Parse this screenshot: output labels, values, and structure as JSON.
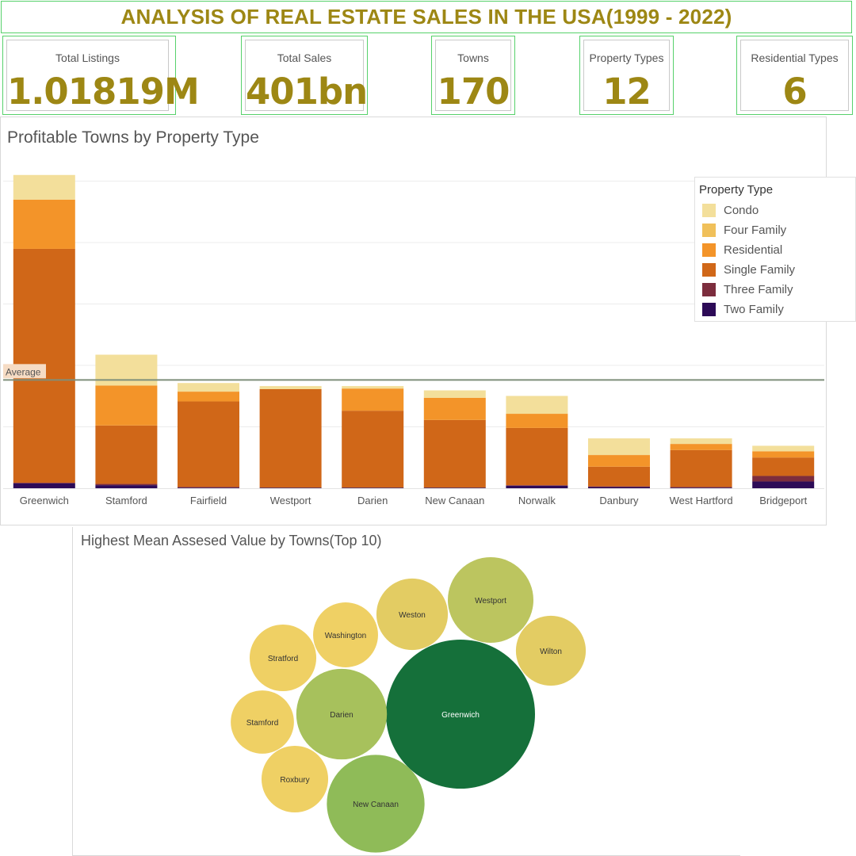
{
  "header": {
    "title": "ANALYSIS OF REAL ESTATE SALES IN THE USA(1999 - 2022)"
  },
  "kpis": [
    {
      "label": "Total Listings",
      "value": "1.01819M"
    },
    {
      "label": "Total Sales",
      "value": "401bn"
    },
    {
      "label": "Towns",
      "value": "170"
    },
    {
      "label": "Property Types",
      "value": "12"
    },
    {
      "label": "Residential Types",
      "value": "6"
    }
  ],
  "colors": {
    "accent": "#9d8714",
    "kpi_border": "#57d16b",
    "Condo": "#f3df9b",
    "Four Family": "#f0c05a",
    "Residential": "#f39429",
    "Single Family": "#d06718",
    "Three Family": "#7c2d3d",
    "Two Family": "#2d0b57",
    "average_line": "#7f8f7a"
  },
  "chart_data": [
    {
      "type": "bar",
      "title": "Profitable Towns by Property Type",
      "stacked": true,
      "categories": [
        "Greenwich",
        "Stamford",
        "Fairfield",
        "Westport",
        "Darien",
        "New Canaan",
        "Norwalk",
        "Danbury",
        "West Hartford",
        "Bridgeport"
      ],
      "legend_title": "Property Type",
      "legend_position": "top-right",
      "grid": true,
      "ylim": [
        0,
        51
      ],
      "series": [
        {
          "name": "Two Family",
          "values": [
            0.8,
            0.5,
            0.1,
            0.1,
            0.1,
            0.1,
            0.4,
            0.2,
            0.1,
            1.1
          ]
        },
        {
          "name": "Three Family",
          "values": [
            0.1,
            0.2,
            0.1,
            0.0,
            0.0,
            0.0,
            0.1,
            0.1,
            0.1,
            0.9
          ]
        },
        {
          "name": "Single Family",
          "values": [
            38.0,
            9.5,
            13.9,
            16.0,
            12.5,
            11.0,
            9.3,
            3.2,
            6.0,
            3.0
          ]
        },
        {
          "name": "Residential",
          "values": [
            8.0,
            6.5,
            1.6,
            0.0,
            3.6,
            3.6,
            2.3,
            1.9,
            1.0,
            1.0
          ]
        },
        {
          "name": "Four Family",
          "values": [
            0.0,
            0.0,
            0.0,
            0.0,
            0.0,
            0.0,
            0.0,
            0.0,
            0.0,
            0.0
          ]
        },
        {
          "name": "Condo",
          "values": [
            4.0,
            5.0,
            1.4,
            0.5,
            0.4,
            1.2,
            2.9,
            2.7,
            0.9,
            0.9
          ]
        }
      ],
      "reference_line": {
        "label": "Average",
        "value": 17.6
      }
    },
    {
      "type": "bubble",
      "title": "Highest Mean Assesed Value by Towns(Top 10)",
      "points": [
        {
          "label": "Greenwich",
          "value": 100
        },
        {
          "label": "New Canaan",
          "value": 43
        },
        {
          "label": "Darien",
          "value": 37
        },
        {
          "label": "Westport",
          "value": 33
        },
        {
          "label": "Weston",
          "value": 23
        },
        {
          "label": "Wilton",
          "value": 22
        },
        {
          "label": "Washington",
          "value": 19
        },
        {
          "label": "Stratford",
          "value": 20
        },
        {
          "label": "Stamford",
          "value": 18
        },
        {
          "label": "Roxbury",
          "value": 20
        }
      ]
    }
  ]
}
